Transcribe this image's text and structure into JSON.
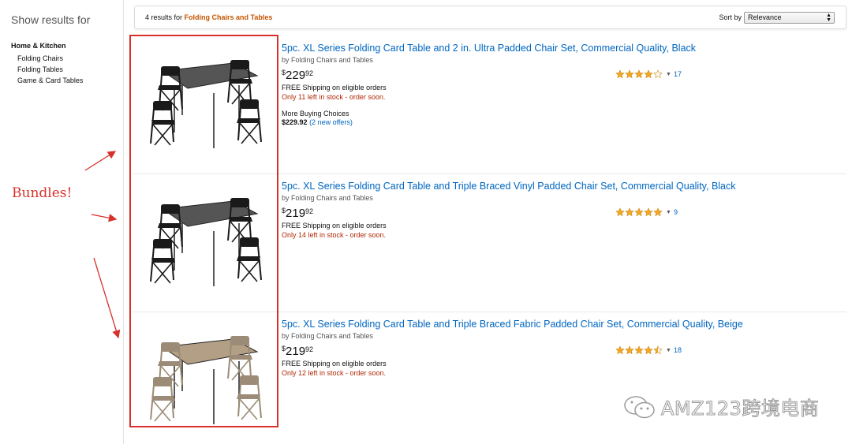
{
  "sidebar": {
    "heading": "Show results for",
    "category": "Home & Kitchen",
    "subcategories": [
      "Folding Chairs",
      "Folding Tables",
      "Game & Card Tables"
    ]
  },
  "topbar": {
    "count_text": "4 results for ",
    "keyword": "Folding Chairs and Tables",
    "sort_label": "Sort by",
    "sort_value": "Relevance"
  },
  "results": [
    {
      "title": "5pc. XL Series Folding Card Table and 2 in. Ultra Padded Chair Set, Commercial Quality, Black",
      "byline": "by Folding Chairs and Tables",
      "price_dollar": "$",
      "price_whole": "229",
      "price_cents": "92",
      "shipping": "FREE Shipping on eligible orders",
      "stock": "Only 11 left in stock - order soon.",
      "more_buying": "More Buying Choices",
      "more_price": "$229.92",
      "more_offers": "(2 new offers)",
      "rating": 4.0,
      "reviews": "17",
      "color": "#1a1a1a"
    },
    {
      "title": "5pc. XL Series Folding Card Table and Triple Braced Vinyl Padded Chair Set, Commercial Quality, Black",
      "byline": "by Folding Chairs and Tables",
      "price_dollar": "$",
      "price_whole": "219",
      "price_cents": "92",
      "shipping": "FREE Shipping on eligible orders",
      "stock": "Only 14 left in stock - order soon.",
      "rating": 5.0,
      "reviews": "9",
      "color": "#1a1a1a"
    },
    {
      "title": "5pc. XL Series Folding Card Table and Triple Braced Fabric Padded Chair Set, Commercial Quality, Beige",
      "byline": "by Folding Chairs and Tables",
      "price_dollar": "$",
      "price_whole": "219",
      "price_cents": "92",
      "shipping": "FREE Shipping on eligible orders",
      "stock": "Only 12 left in stock - order soon.",
      "rating": 4.5,
      "reviews": "18",
      "color": "#9c8b76"
    }
  ],
  "annotation": {
    "label": "Bundles!",
    "color": "#d8312b"
  },
  "watermark": {
    "text": "AMZ123跨境电商"
  },
  "icons": {
    "star": "star-icon",
    "caret": "caret-down-icon",
    "select_arrow": "select-arrows-icon"
  },
  "colors": {
    "link": "#0066c0",
    "keyword": "#c45500",
    "stock": "#b12704",
    "star": "#f5a623"
  }
}
